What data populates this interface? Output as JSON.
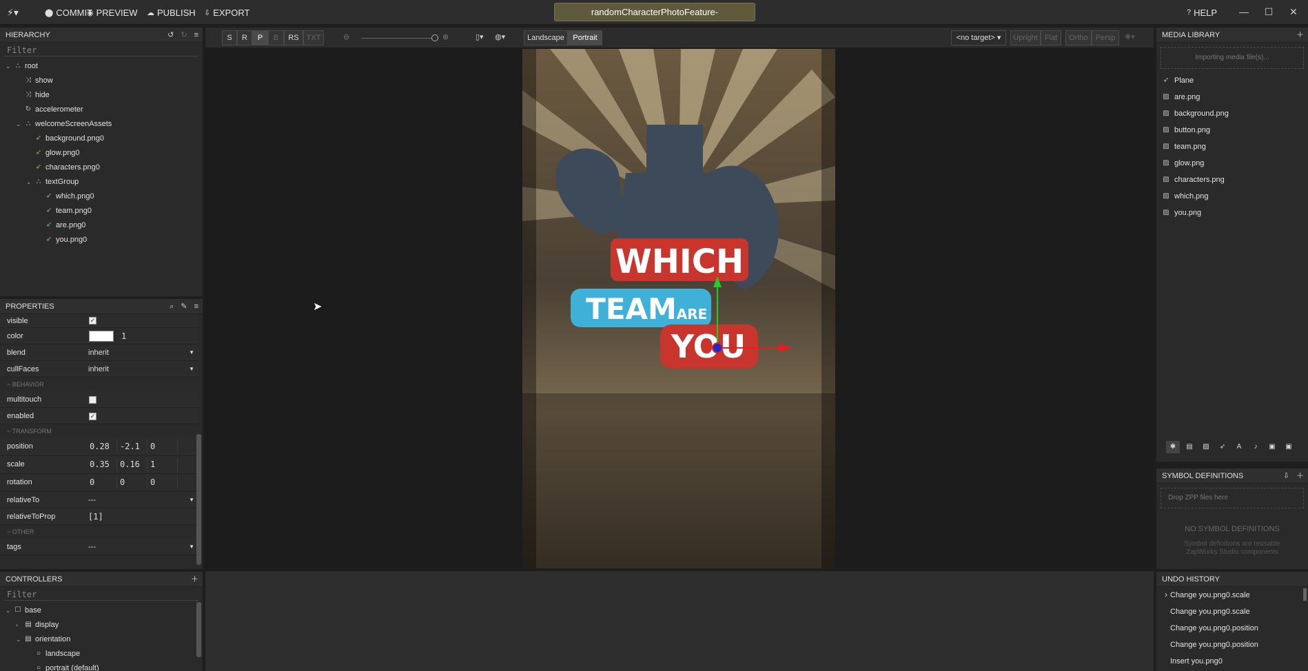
{
  "toolbar": {
    "commit": "COMMIT",
    "preview": "PREVIEW",
    "publish": "PUBLISH",
    "export": "EXPORT",
    "help": "HELP",
    "document_title": "randomCharacterPhotoFeature-"
  },
  "hierarchy": {
    "title": "HIERARCHY",
    "filter_placeholder": "Filter",
    "items": [
      {
        "label": "root",
        "depth": 0,
        "icon": "group-icon",
        "arrow": "v"
      },
      {
        "label": "show",
        "depth": 1,
        "icon": "shuffle-icon",
        "arrow": ""
      },
      {
        "label": "hide",
        "depth": 1,
        "icon": "shuffle-icon",
        "arrow": ""
      },
      {
        "label": "accelerometer",
        "depth": 1,
        "icon": "refresh-icon",
        "arrow": ""
      },
      {
        "label": "welcomeScreenAssets",
        "depth": 1,
        "icon": "group-icon",
        "arrow": "v"
      },
      {
        "label": "background.png0",
        "depth": 2,
        "icon": "plane-icon",
        "arrow": ""
      },
      {
        "label": "glow.png0",
        "depth": 2,
        "icon": "plane-icon",
        "arrow": ""
      },
      {
        "label": "characters.png0",
        "depth": 2,
        "icon": "plane-icon",
        "arrow": ""
      },
      {
        "label": "textGroup",
        "depth": 2,
        "icon": "group-icon",
        "arrow": "v"
      },
      {
        "label": "which.png0",
        "depth": 3,
        "icon": "plane-icon",
        "arrow": ""
      },
      {
        "label": "team.png0",
        "depth": 3,
        "icon": "plane-icon",
        "arrow": ""
      },
      {
        "label": "are.png0",
        "depth": 3,
        "icon": "plane-icon",
        "arrow": ""
      },
      {
        "label": "you.png0",
        "depth": 3,
        "icon": "plane-icon",
        "arrow": ""
      }
    ]
  },
  "properties": {
    "title": "PROPERTIES",
    "visible_label": "visible",
    "color_label": "color",
    "color_alpha": "1",
    "blend_label": "blend",
    "blend_value": "inherit",
    "cullfaces_label": "cullFaces",
    "cullfaces_value": "inherit",
    "behavior_section": "~ BEHAVIOR",
    "multitouch_label": "multitouch",
    "enabled_label": "enabled",
    "transform_section": "~ TRANSFORM",
    "position_label": "position",
    "position": [
      "0.28",
      "-2.1",
      "0"
    ],
    "scale_label": "scale",
    "scale": [
      "0.35",
      "0.16",
      "1"
    ],
    "rotation_label": "rotation",
    "rotation": [
      "0",
      "0",
      "0"
    ],
    "relativeto_label": "relativeTo",
    "relativeto_value": "---",
    "relativetoprop_label": "relativeToProp",
    "relativetoprop_value": "[1]",
    "other_section": "~ OTHER",
    "tags_label": "tags",
    "tags_value": "---"
  },
  "controllers": {
    "title": "CONTROLLERS",
    "filter_placeholder": "Filter",
    "items": [
      {
        "label": "base",
        "depth": 0,
        "arrow": "v",
        "icon": "square-icon"
      },
      {
        "label": "display",
        "depth": 1,
        "arrow": ">",
        "icon": "list-icon"
      },
      {
        "label": "orientation",
        "depth": 1,
        "arrow": "v",
        "icon": "list-icon"
      },
      {
        "label": "landscape",
        "depth": 2,
        "arrow": "",
        "icon": "radio-icon"
      },
      {
        "label": "portrait (default)",
        "depth": 2,
        "arrow": "",
        "icon": "radio-icon"
      }
    ]
  },
  "viewport": {
    "tools": [
      "S",
      "R",
      "P",
      "B",
      "RS",
      "TXT"
    ],
    "landscape": "Landscape",
    "portrait": "Portrait",
    "target": "<no target>",
    "upright": "Upright",
    "flat": "Flat",
    "ortho": "Ortho",
    "persp": "Persp",
    "art_text": {
      "which": "WHICH",
      "team": "TEAM",
      "are": "ARE",
      "you": "YOU"
    }
  },
  "media_library": {
    "title": "MEDIA LIBRARY",
    "import_placeholder": "Importing media file(s)...",
    "items": [
      {
        "label": "Plane",
        "icon": "plane-icon"
      },
      {
        "label": "are.png",
        "icon": "image-icon"
      },
      {
        "label": "background.png",
        "icon": "image-icon"
      },
      {
        "label": "button.png",
        "icon": "image-icon"
      },
      {
        "label": "team.png",
        "icon": "image-icon"
      },
      {
        "label": "glow.png",
        "icon": "image-icon"
      },
      {
        "label": "characters.png",
        "icon": "image-icon"
      },
      {
        "label": "which.png",
        "icon": "image-icon"
      },
      {
        "label": "you.png",
        "icon": "image-icon"
      }
    ]
  },
  "symbols": {
    "title": "SYMBOL DEFINITIONS",
    "drop_placeholder": "Drop ZPP files here",
    "empty_title": "NO SYMBOL DEFINITIONS",
    "empty_desc_1": "Symbol definitions are reusable",
    "empty_desc_2": "ZapWorks Studio components"
  },
  "undo_history": {
    "title": "UNDO HISTORY",
    "items": [
      "Change you.png0.scale",
      "Change you.png0.scale",
      "Change you.png0.position",
      "Change you.png0.position",
      "Insert you.png0"
    ]
  }
}
